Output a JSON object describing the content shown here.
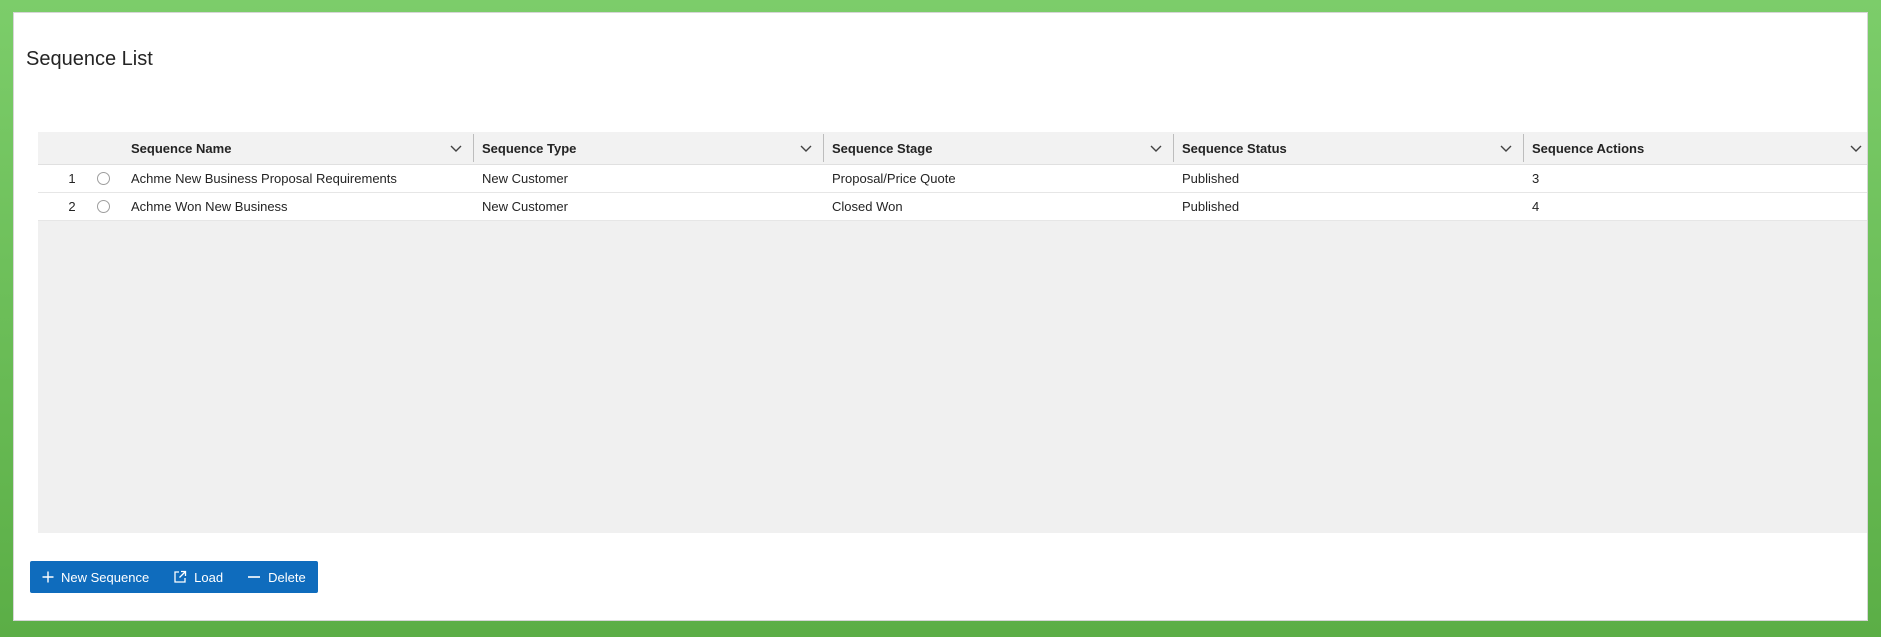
{
  "page": {
    "title": "Sequence List"
  },
  "grid": {
    "columns": [
      {
        "label": "Sequence Name"
      },
      {
        "label": "Sequence Type"
      },
      {
        "label": "Sequence Stage"
      },
      {
        "label": "Sequence Status"
      },
      {
        "label": "Sequence Actions"
      }
    ],
    "rows": [
      {
        "num": "1",
        "name": "Achme New Business Proposal Requirements",
        "type": "New Customer",
        "stage": "Proposal/Price Quote",
        "status": "Published",
        "actions": "3"
      },
      {
        "num": "2",
        "name": "Achme Won New Business",
        "type": "New Customer",
        "stage": "Closed Won",
        "status": "Published",
        "actions": "4"
      }
    ]
  },
  "toolbar": {
    "new_label": "New Sequence",
    "load_label": "Load",
    "delete_label": "Delete"
  },
  "icons": {
    "column_menu": "chevron-down-icon",
    "new": "plus-icon",
    "load": "open-external-icon",
    "delete": "minus-icon",
    "row_select": "radio-icon"
  },
  "colors": {
    "frame": "#5fb04a",
    "accent": "#0f6cbd",
    "grid_header_bg": "#f2f2f2",
    "grid_empty_bg": "#f0f0f0"
  }
}
